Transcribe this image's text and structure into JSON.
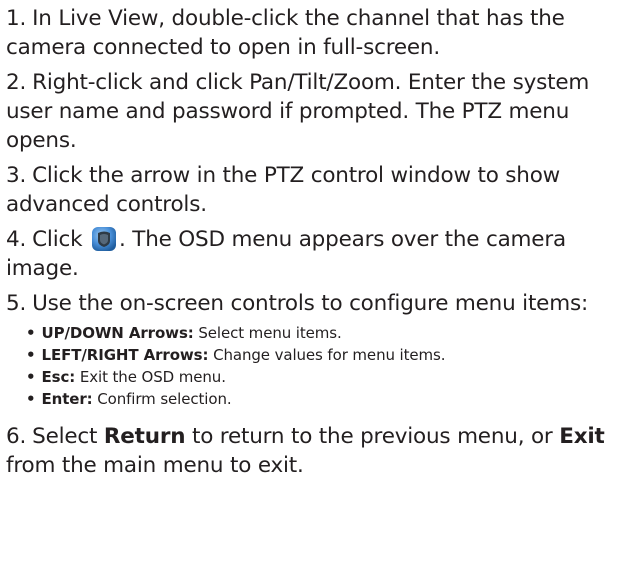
{
  "steps": [
    {
      "num": "1.",
      "text": "In Live View, double-click the channel that has the camera connected to open in full-screen."
    },
    {
      "num": "2.",
      "text": "Right-click and click Pan/Tilt/Zoom. Enter the system user name and password if prompted. The PTZ menu opens."
    },
    {
      "num": "3.",
      "text": "Click the arrow in the PTZ control window to show advanced controls."
    },
    {
      "num": "4.",
      "pre": "Click",
      "icon": "osd-menu-icon",
      "post": ". The OSD menu appears over the camera image."
    },
    {
      "num": "5.",
      "text": "Use the on-screen controls to configure menu items:"
    },
    {
      "num": "6.",
      "pre": "Select",
      "bold1": "Return",
      "mid": "to return to the previous menu, or",
      "bold2": "Exit",
      "post": "from the main menu to exit."
    }
  ],
  "controls": [
    {
      "key": "UP/DOWN Arrows:",
      "desc": "Select menu items."
    },
    {
      "key": "LEFT/RIGHT Arrows:",
      "desc": "Change values for menu items."
    },
    {
      "key": "Esc:",
      "desc": "Exit the OSD menu."
    },
    {
      "key": "Enter:",
      "desc": "Confirm selection."
    }
  ],
  "bullet": "•",
  "colors": {
    "text": "#231f20",
    "icon_bg": "#4a90d9"
  }
}
